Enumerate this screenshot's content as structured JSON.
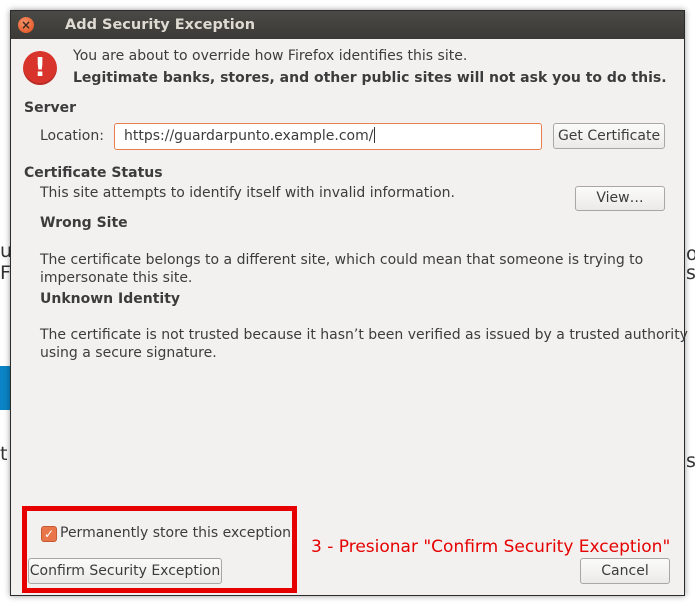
{
  "dialog": {
    "title": "Add Security Exception",
    "close_glyph": "×"
  },
  "warning": {
    "line1": "You are about to override how Firefox identifies this site.",
    "line2": "Legitimate banks, stores, and other public sites will not ask you to do this."
  },
  "server": {
    "heading": "Server",
    "location_label": "Location:",
    "location_value": "https://guardarpunto.example.com/",
    "get_certificate_label": "Get Certificate"
  },
  "certificate_status": {
    "heading": "Certificate Status",
    "summary": "This site attempts to identify itself with invalid information.",
    "view_button": "View…",
    "wrong_site_heading": "Wrong Site",
    "wrong_site_line1": "The certificate belongs to a different site, which could mean that someone is trying to",
    "wrong_site_line2": "impersonate this site.",
    "unknown_identity_heading": "Unknown Identity",
    "unknown_identity_line1": "The certificate is not trusted because it hasn’t been verified as issued by a trusted authority",
    "unknown_identity_line2": "using a secure signature."
  },
  "footer": {
    "permanent_store_label": "Permanently store this exception",
    "permanent_store_checked": true,
    "confirm_button": "Confirm Security Exception",
    "cancel_button": "Cancel"
  },
  "annotation": {
    "text": "3 - Presionar \"Confirm Security Exception\"",
    "color": "#e60000"
  },
  "colors": {
    "accent": "#e8764a",
    "titlebar": "#3b3a37",
    "warning": "#d9342b"
  }
}
